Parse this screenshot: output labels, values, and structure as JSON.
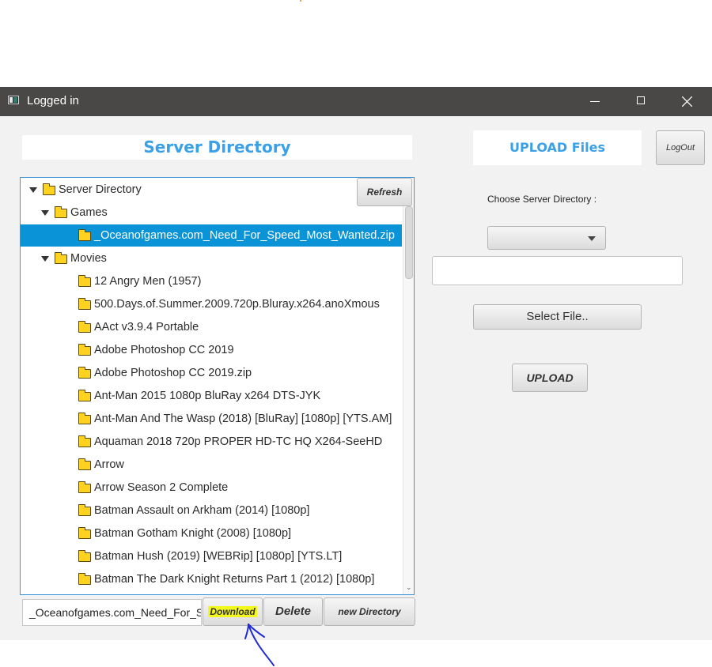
{
  "window": {
    "title": "Logged in"
  },
  "left_panel": {
    "title": "Server Directory",
    "refresh_label": "Refresh",
    "tree": [
      {
        "label": "Server Directory",
        "level": 0,
        "expanded": true
      },
      {
        "label": "Games",
        "level": 1,
        "expanded": true
      },
      {
        "label": "_Oceanofgames.com_Need_For_Speed_Most_Wanted.zip",
        "level": 2,
        "selected": true
      },
      {
        "label": "Movies",
        "level": 1,
        "expanded": true
      },
      {
        "label": "12 Angry Men (1957)",
        "level": 2
      },
      {
        "label": "500.Days.of.Summer.2009.720p.Bluray.x264.anoXmous",
        "level": 2
      },
      {
        "label": "AAct v3.9.4 Portable",
        "level": 2
      },
      {
        "label": "Adobe Photoshop CC 2019",
        "level": 2
      },
      {
        "label": "Adobe Photoshop CC 2019.zip",
        "level": 2
      },
      {
        "label": "Ant-Man 2015 1080p BluRay x264 DTS-JYK",
        "level": 2
      },
      {
        "label": "Ant-Man And The Wasp (2018) [BluRay] [1080p] [YTS.AM]",
        "level": 2
      },
      {
        "label": "Aquaman 2018 720p PROPER HD-TC HQ X264-SeeHD",
        "level": 2
      },
      {
        "label": "Arrow",
        "level": 2
      },
      {
        "label": "Arrow Season 2 Complete",
        "level": 2
      },
      {
        "label": "Batman Assault on Arkham (2014) [1080p]",
        "level": 2
      },
      {
        "label": "Batman Gotham Knight (2008) [1080p]",
        "level": 2
      },
      {
        "label": "Batman Hush (2019) [WEBRip] [1080p] [YTS.LT]",
        "level": 2
      },
      {
        "label": "Batman The Dark Knight Returns Part 1 (2012) [1080p]",
        "level": 2
      }
    ],
    "selected_file_value": "_Oceanofgames.com_Need_For_Speed_Most_Wanted.zip",
    "download_label": "Download",
    "delete_label": "Delete",
    "new_directory_label": "new Directory"
  },
  "right_panel": {
    "title": "UPLOAD Files",
    "logout_label": "LogOut",
    "choose_label": "Choose Server Directory :",
    "combo_value": "",
    "path_value": "",
    "select_file_label": "Select File..",
    "upload_label": "UPLOAD"
  },
  "colors": {
    "accent": "#3aa0e8",
    "selection": "#0a93d7",
    "highlight": "#f4f71c",
    "annotation": "#1f2bd6"
  }
}
